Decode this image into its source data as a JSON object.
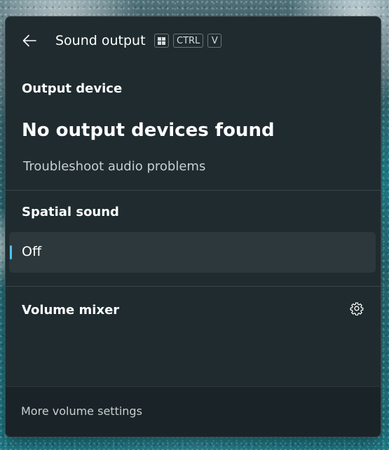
{
  "flyout": {
    "title": "Sound output",
    "shortcut_keys": [
      "CTRL",
      "V"
    ],
    "output_device": {
      "label": "Output device",
      "status": "No output devices found",
      "troubleshoot_link": "Troubleshoot audio problems"
    },
    "spatial_sound": {
      "label": "Spatial sound",
      "selected_value": "Off"
    },
    "volume_mixer": {
      "label": "Volume mixer"
    },
    "footer": {
      "more_settings": "More volume settings"
    }
  },
  "colors": {
    "accent": "#4cc2ff",
    "panel_bg": "#1f2b2f",
    "selected_item_bg": "#2c383b",
    "footer_bg": "#1a2428"
  },
  "icons": [
    "back-arrow-icon",
    "windows-key-icon",
    "gear-icon"
  ]
}
